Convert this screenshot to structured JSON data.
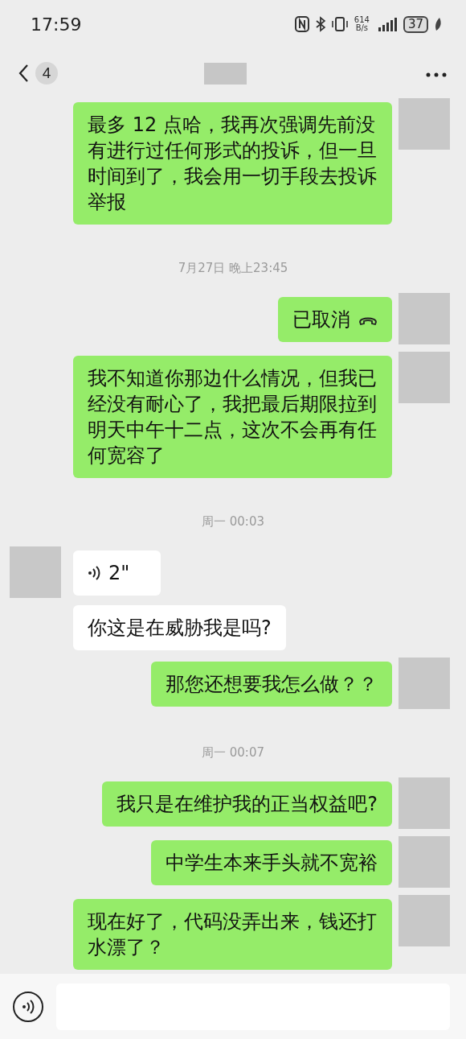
{
  "status_bar": {
    "time": "17:59",
    "speed_value": "614",
    "speed_unit": "B/s",
    "battery": "37"
  },
  "header": {
    "unread_count": "4"
  },
  "messages": [
    {
      "kind": "text",
      "outgoing": true,
      "show_avatar": true,
      "text": "最多 12 点哈，我再次强调先前没有进行过任何形式的投诉，但一旦时间到了，我会用一切手段去投诉举报"
    },
    {
      "kind": "time",
      "text": "7月27日 晚上23:45"
    },
    {
      "kind": "call",
      "outgoing": true,
      "show_avatar": true,
      "text": "已取消"
    },
    {
      "kind": "text",
      "outgoing": true,
      "show_avatar": true,
      "text": "我不知道你那边什么情况，但我已经没有耐心了，我把最后期限拉到明天中午十二点，这次不会再有任何宽容了"
    },
    {
      "kind": "time",
      "text": "周一 00:03"
    },
    {
      "kind": "voice",
      "outgoing": false,
      "show_avatar": true,
      "text": "2\""
    },
    {
      "kind": "text",
      "outgoing": false,
      "show_avatar": false,
      "text": "你这是在威胁我是吗?"
    },
    {
      "kind": "text",
      "outgoing": true,
      "show_avatar": true,
      "text": "那您还想要我怎么做？？"
    },
    {
      "kind": "time",
      "text": "周一 00:07"
    },
    {
      "kind": "text",
      "outgoing": true,
      "show_avatar": true,
      "text": "我只是在维护我的正当权益吧?"
    },
    {
      "kind": "text",
      "outgoing": true,
      "show_avatar": true,
      "text": "中学生本来手头就不宽裕"
    },
    {
      "kind": "text",
      "outgoing": true,
      "show_avatar": true,
      "text": "现在好了，代码没弄出来，钱还打水漂了？"
    }
  ]
}
